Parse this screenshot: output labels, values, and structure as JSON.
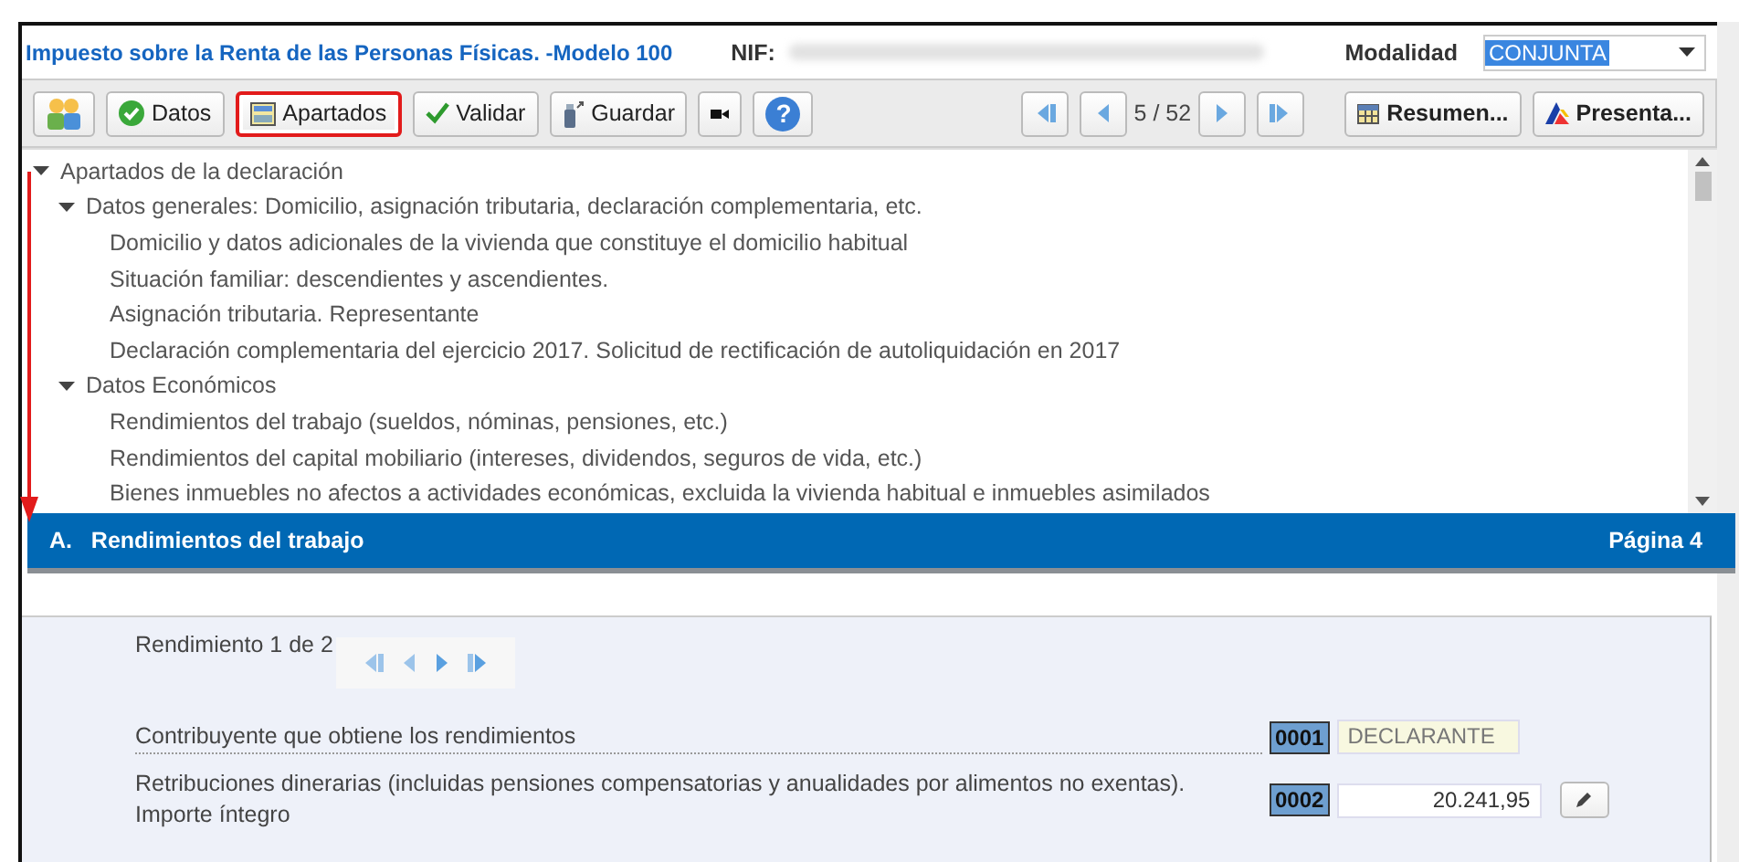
{
  "window": {
    "title": "Impuesto sobre la Renta de las Personas Físicas. -Modelo 100",
    "nif_label": "NIF:",
    "modalidad_label": "Modalidad",
    "modalidad_value": "CONJUNTA"
  },
  "toolbar": {
    "buttons": [
      {
        "kind": "icon",
        "highlighted": false
      },
      {
        "kind": "labeled",
        "label": "Datos",
        "highlighted": false
      },
      {
        "kind": "labeled",
        "label": "Apartados",
        "highlighted": true
      },
      {
        "kind": "labeled",
        "label": "Validar",
        "highlighted": false
      },
      {
        "kind": "labeled",
        "label": "Guardar",
        "highlighted": false
      },
      {
        "kind": "icon",
        "highlighted": false
      },
      {
        "kind": "icon",
        "label": "?",
        "highlighted": false
      }
    ],
    "page_counter": "5 / 52",
    "right_buttons": [
      "Resumen...",
      "Presenta..."
    ]
  },
  "tree": [
    {
      "label": "Apartados de la declaración",
      "expanded": true,
      "children": [
        {
          "label": "Datos generales: Domicilio, asignación tributaria, declaración complementaria, etc.",
          "expanded": true,
          "children": [
            {
              "label": "Domicilio y datos adicionales de la vivienda que constituye el domicilio habitual"
            },
            {
              "label": "Situación familiar: descendientes y ascendientes."
            },
            {
              "label": "Asignación tributaria. Representante"
            },
            {
              "label": "Declaración complementaria del ejercicio 2017. Solicitud de rectificación de autoliquidación en 2017"
            }
          ]
        },
        {
          "label": "Datos Económicos",
          "expanded": true,
          "children": [
            {
              "label": "Rendimientos del trabajo (sueldos, nóminas, pensiones, etc.)"
            },
            {
              "label": "Rendimientos del capital mobiliario (intereses, dividendos, seguros de vida, etc.)"
            },
            {
              "label": "Bienes inmuebles no afectos a actividades económicas, excluida la vivienda habitual e inmuebles asimilados"
            }
          ]
        }
      ]
    }
  ],
  "section": {
    "title": "A.   Rendimientos del trabajo",
    "page": "Página 4"
  },
  "form": {
    "record_label": "Rendimiento 1 de 2",
    "rows": [
      {
        "kind": "text",
        "label": "Contribuyente que obtiene los rendimientos",
        "code": "0001",
        "value": "DECLARANTE"
      },
      {
        "kind": "amount",
        "label": "Retribuciones dinerarias (incluidas pensiones compensatorias y anualidades por alimentos no exentas). Importe íntegro",
        "code": "0002",
        "value": "20.241,95"
      }
    ]
  }
}
